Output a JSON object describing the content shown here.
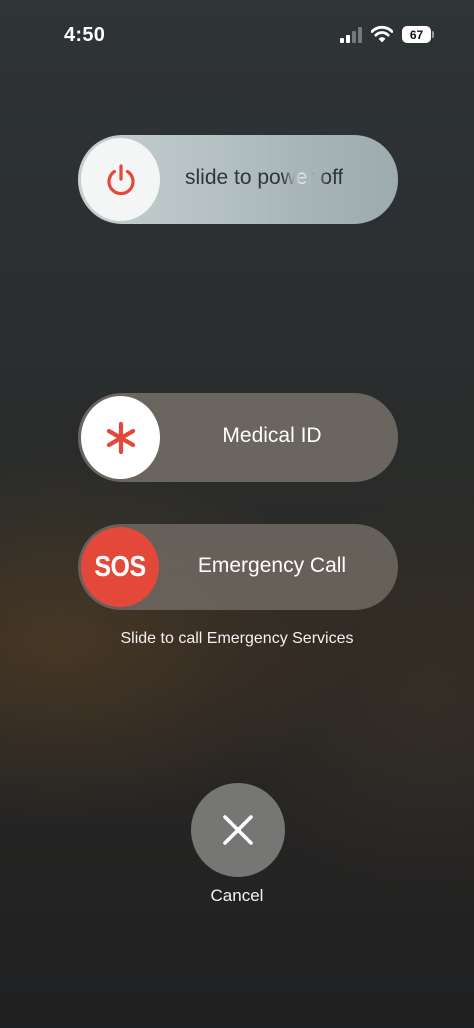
{
  "status_bar": {
    "time": "4:50",
    "signal_icon": "cellular-signal-icon",
    "wifi_icon": "wifi-icon",
    "battery_level": "67"
  },
  "power_slider": {
    "label": "slide to power off",
    "icon": "power-icon",
    "icon_color": "#e4483b"
  },
  "medical_slider": {
    "label": "Medical ID",
    "icon": "asterisk-icon",
    "icon_color": "#e4483b"
  },
  "sos_slider": {
    "knob_text": "SOS",
    "label": "Emergency Call",
    "knob_color": "#e4483b"
  },
  "hint": "Slide to call Emergency Services",
  "cancel": {
    "icon": "close-icon",
    "label": "Cancel"
  }
}
